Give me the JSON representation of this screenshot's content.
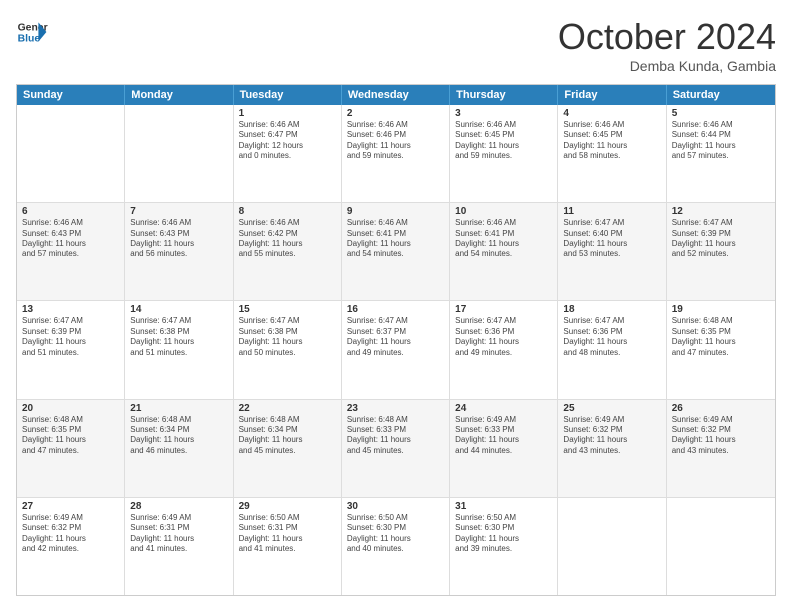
{
  "logo": {
    "line1": "General",
    "line2": "Blue",
    "icon": "▶"
  },
  "title": "October 2024",
  "location": "Demba Kunda, Gambia",
  "weekdays": [
    "Sunday",
    "Monday",
    "Tuesday",
    "Wednesday",
    "Thursday",
    "Friday",
    "Saturday"
  ],
  "rows": [
    [
      {
        "day": "",
        "info": ""
      },
      {
        "day": "",
        "info": ""
      },
      {
        "day": "1",
        "info": "Sunrise: 6:46 AM\nSunset: 6:47 PM\nDaylight: 12 hours\nand 0 minutes."
      },
      {
        "day": "2",
        "info": "Sunrise: 6:46 AM\nSunset: 6:46 PM\nDaylight: 11 hours\nand 59 minutes."
      },
      {
        "day": "3",
        "info": "Sunrise: 6:46 AM\nSunset: 6:45 PM\nDaylight: 11 hours\nand 59 minutes."
      },
      {
        "day": "4",
        "info": "Sunrise: 6:46 AM\nSunset: 6:45 PM\nDaylight: 11 hours\nand 58 minutes."
      },
      {
        "day": "5",
        "info": "Sunrise: 6:46 AM\nSunset: 6:44 PM\nDaylight: 11 hours\nand 57 minutes."
      }
    ],
    [
      {
        "day": "6",
        "info": "Sunrise: 6:46 AM\nSunset: 6:43 PM\nDaylight: 11 hours\nand 57 minutes."
      },
      {
        "day": "7",
        "info": "Sunrise: 6:46 AM\nSunset: 6:43 PM\nDaylight: 11 hours\nand 56 minutes."
      },
      {
        "day": "8",
        "info": "Sunrise: 6:46 AM\nSunset: 6:42 PM\nDaylight: 11 hours\nand 55 minutes."
      },
      {
        "day": "9",
        "info": "Sunrise: 6:46 AM\nSunset: 6:41 PM\nDaylight: 11 hours\nand 54 minutes."
      },
      {
        "day": "10",
        "info": "Sunrise: 6:46 AM\nSunset: 6:41 PM\nDaylight: 11 hours\nand 54 minutes."
      },
      {
        "day": "11",
        "info": "Sunrise: 6:47 AM\nSunset: 6:40 PM\nDaylight: 11 hours\nand 53 minutes."
      },
      {
        "day": "12",
        "info": "Sunrise: 6:47 AM\nSunset: 6:39 PM\nDaylight: 11 hours\nand 52 minutes."
      }
    ],
    [
      {
        "day": "13",
        "info": "Sunrise: 6:47 AM\nSunset: 6:39 PM\nDaylight: 11 hours\nand 51 minutes."
      },
      {
        "day": "14",
        "info": "Sunrise: 6:47 AM\nSunset: 6:38 PM\nDaylight: 11 hours\nand 51 minutes."
      },
      {
        "day": "15",
        "info": "Sunrise: 6:47 AM\nSunset: 6:38 PM\nDaylight: 11 hours\nand 50 minutes."
      },
      {
        "day": "16",
        "info": "Sunrise: 6:47 AM\nSunset: 6:37 PM\nDaylight: 11 hours\nand 49 minutes."
      },
      {
        "day": "17",
        "info": "Sunrise: 6:47 AM\nSunset: 6:36 PM\nDaylight: 11 hours\nand 49 minutes."
      },
      {
        "day": "18",
        "info": "Sunrise: 6:47 AM\nSunset: 6:36 PM\nDaylight: 11 hours\nand 48 minutes."
      },
      {
        "day": "19",
        "info": "Sunrise: 6:48 AM\nSunset: 6:35 PM\nDaylight: 11 hours\nand 47 minutes."
      }
    ],
    [
      {
        "day": "20",
        "info": "Sunrise: 6:48 AM\nSunset: 6:35 PM\nDaylight: 11 hours\nand 47 minutes."
      },
      {
        "day": "21",
        "info": "Sunrise: 6:48 AM\nSunset: 6:34 PM\nDaylight: 11 hours\nand 46 minutes."
      },
      {
        "day": "22",
        "info": "Sunrise: 6:48 AM\nSunset: 6:34 PM\nDaylight: 11 hours\nand 45 minutes."
      },
      {
        "day": "23",
        "info": "Sunrise: 6:48 AM\nSunset: 6:33 PM\nDaylight: 11 hours\nand 45 minutes."
      },
      {
        "day": "24",
        "info": "Sunrise: 6:49 AM\nSunset: 6:33 PM\nDaylight: 11 hours\nand 44 minutes."
      },
      {
        "day": "25",
        "info": "Sunrise: 6:49 AM\nSunset: 6:32 PM\nDaylight: 11 hours\nand 43 minutes."
      },
      {
        "day": "26",
        "info": "Sunrise: 6:49 AM\nSunset: 6:32 PM\nDaylight: 11 hours\nand 43 minutes."
      }
    ],
    [
      {
        "day": "27",
        "info": "Sunrise: 6:49 AM\nSunset: 6:32 PM\nDaylight: 11 hours\nand 42 minutes."
      },
      {
        "day": "28",
        "info": "Sunrise: 6:49 AM\nSunset: 6:31 PM\nDaylight: 11 hours\nand 41 minutes."
      },
      {
        "day": "29",
        "info": "Sunrise: 6:50 AM\nSunset: 6:31 PM\nDaylight: 11 hours\nand 41 minutes."
      },
      {
        "day": "30",
        "info": "Sunrise: 6:50 AM\nSunset: 6:30 PM\nDaylight: 11 hours\nand 40 minutes."
      },
      {
        "day": "31",
        "info": "Sunrise: 6:50 AM\nSunset: 6:30 PM\nDaylight: 11 hours\nand 39 minutes."
      },
      {
        "day": "",
        "info": ""
      },
      {
        "day": "",
        "info": ""
      }
    ]
  ]
}
